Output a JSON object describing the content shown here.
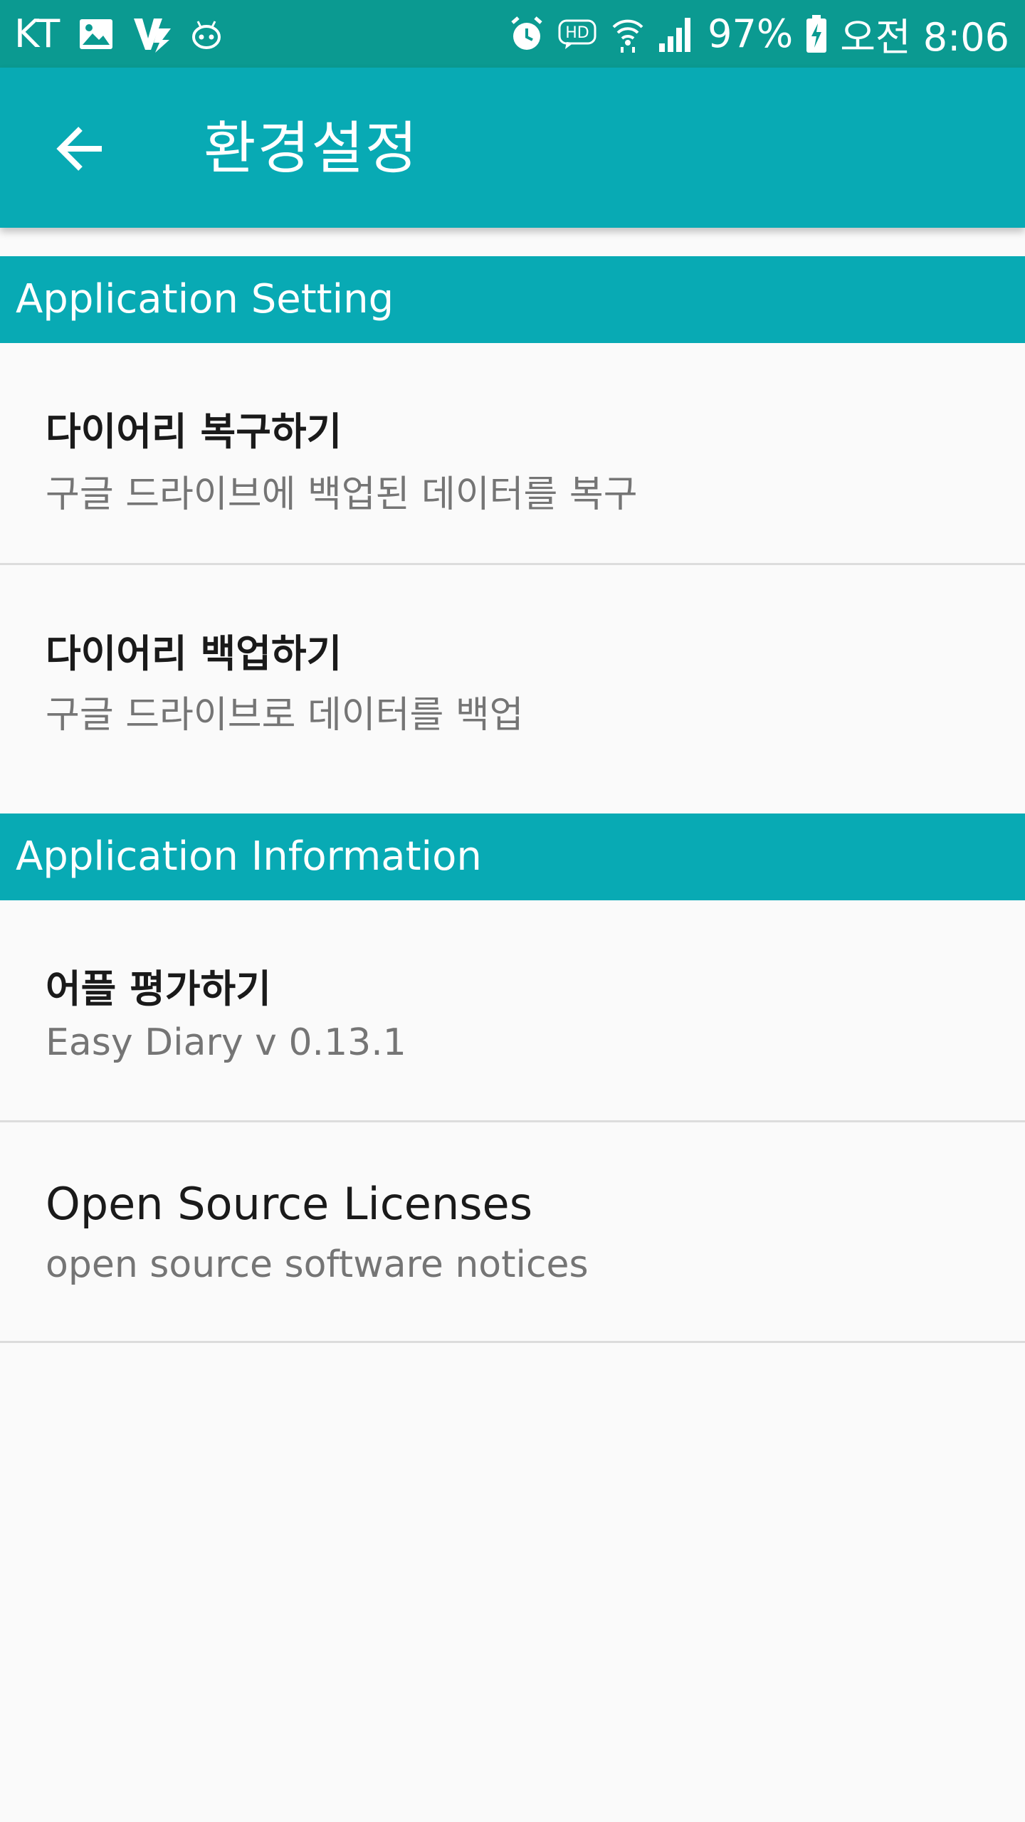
{
  "status_bar": {
    "carrier": "KT",
    "battery_percent": "97%",
    "time": "오전 8:06",
    "icons": [
      "image-icon",
      "v3-app-icon",
      "android-icon",
      "alarm-icon",
      "hd-voice-icon",
      "wifi-icon",
      "signal-icon",
      "battery-charging-icon"
    ]
  },
  "app_bar": {
    "title": "환경설정",
    "back_icon": "arrow-left-icon"
  },
  "sections": [
    {
      "header": "Application Setting",
      "items": [
        {
          "title": "다이어리 복구하기",
          "summary": "구글 드라이브에 백업된 데이터를 복구"
        },
        {
          "title": "다이어리 백업하기",
          "summary": "구글 드라이브로 데이터를 백업"
        }
      ]
    },
    {
      "header": "Application Information",
      "items": [
        {
          "title": "어플 평가하기",
          "summary": "Easy Diary v 0.13.1"
        },
        {
          "title": "Open Source Licenses",
          "summary": "open source software notices"
        }
      ]
    }
  ],
  "colors": {
    "status_bar": "#0b9a91",
    "primary": "#08aab4",
    "background": "#fafafa",
    "divider": "#dcdcdc",
    "title_text": "#1a1a1a",
    "summary_text": "#757575"
  }
}
